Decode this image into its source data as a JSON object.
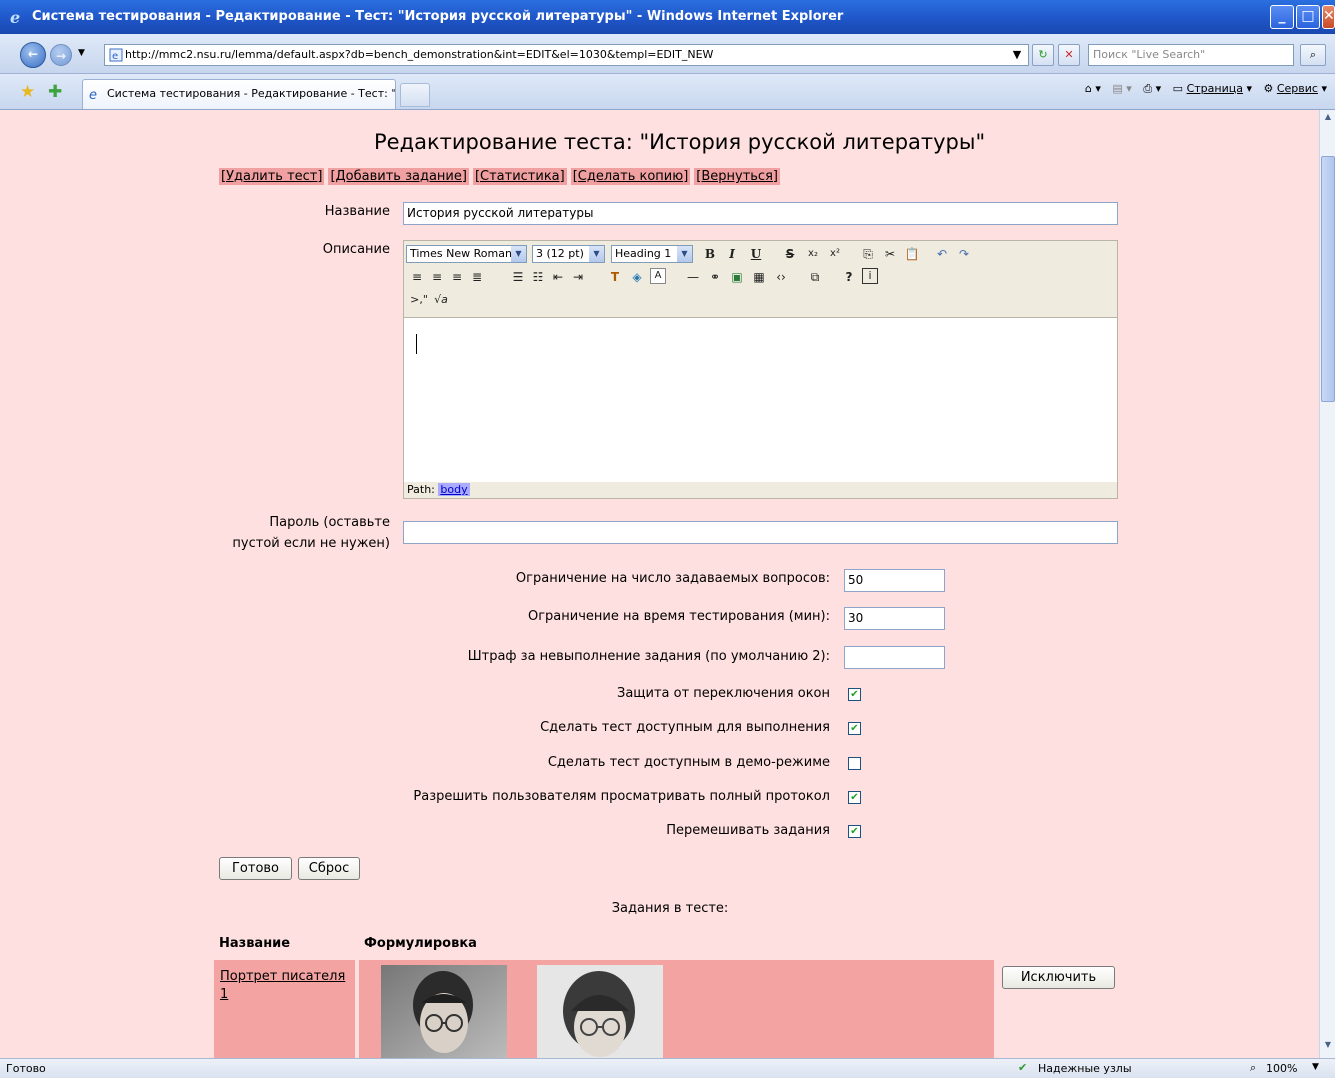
{
  "window": {
    "title": "Система тестирования - Редактирование - Тест: \"История русской литературы\" - Windows Internet Explorer",
    "minimize_icon": "minimize-icon",
    "maximize_icon": "maximize-icon",
    "close_icon": "close-icon"
  },
  "addressbar": {
    "url": "http://mmc2.nsu.ru/lemma/default.aspx?db=bench_demonstration&int=EDIT&el=1030&templ=EDIT_NEW",
    "search_placeholder": "Поиск \"Live Search\""
  },
  "tabs": [
    {
      "label": "Система тестирования - Редактирование - Тест: \"...",
      "active": true
    }
  ],
  "command_bar": {
    "page_label": "Страница",
    "tools_label": "Сервис"
  },
  "page": {
    "heading": "Редактирование теста: \"История русской литературы\"",
    "actions": [
      "[Удалить тест]",
      "[Добавить задание]",
      "[Статистика]",
      "[Сделать копию]",
      "[Вернуться]"
    ],
    "name_label": "Название",
    "name_value": "История русской литературы",
    "description_label": "Описание",
    "editor": {
      "font_name": "Times New Roman",
      "font_size": "3 (12 pt)",
      "format": "Heading 1",
      "path_label": "Path:",
      "path_value": "body"
    },
    "password_label_line1": "Пароль (оставьте",
    "password_label_line2": "пустой если не нужен)",
    "password_value": "",
    "settings": [
      {
        "label": "Ограничение на число задаваемых вопросов:",
        "value": "50"
      },
      {
        "label": "Ограничение на время тестирования (мин):",
        "value": "30"
      },
      {
        "label": "Штраф за невыполнение задания (по умолчанию 2):",
        "value": ""
      }
    ],
    "checkboxes": [
      {
        "label": "Защита от переключения окон",
        "checked": true
      },
      {
        "label": "Сделать тест доступным для выполнения",
        "checked": true
      },
      {
        "label": "Сделать тест доступным в демо-режиме",
        "checked": false
      },
      {
        "label": "Разрешить пользователям просматривать полный протокол",
        "checked": true
      },
      {
        "label": "Перемешивать задания",
        "checked": true
      }
    ],
    "submit_label": "Готово",
    "reset_label": "Сброс",
    "tasks_heading": "Задания в тесте:",
    "table_headers": [
      "Название",
      "Формулировка"
    ],
    "tasks": [
      {
        "name_line1": "Портрет писателя",
        "name_line2": "1",
        "exclude_label": "Исключить"
      }
    ]
  },
  "status": {
    "text": "Готово",
    "zone": "Надежные узлы",
    "zoom": "100%"
  }
}
